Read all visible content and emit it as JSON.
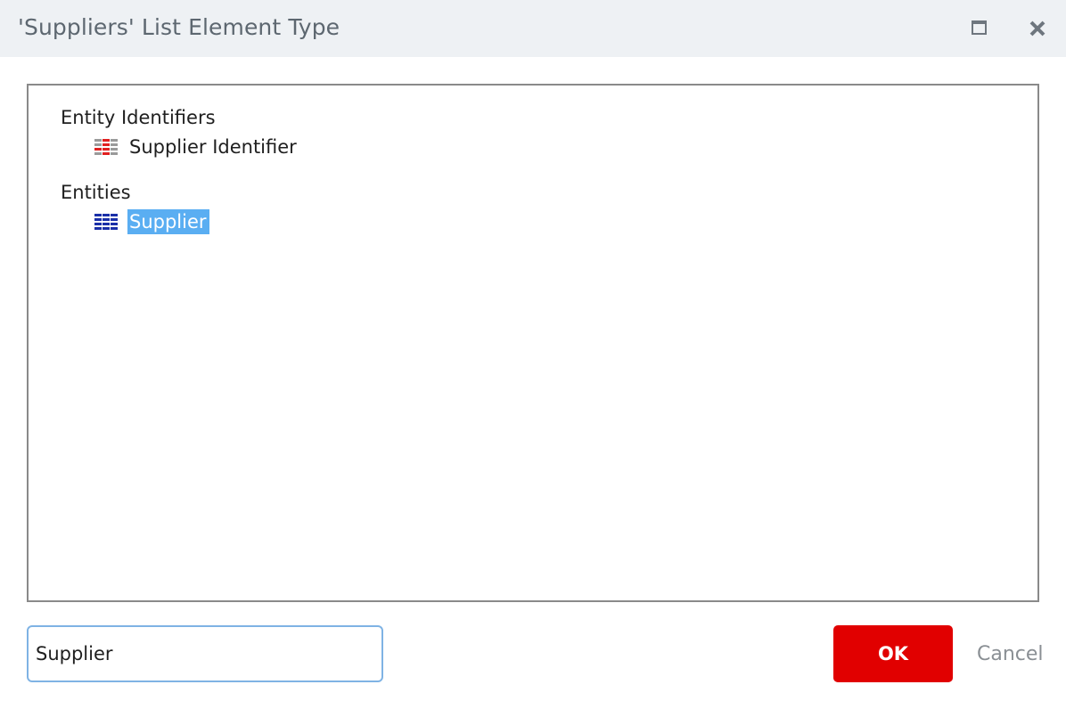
{
  "dialog": {
    "title": "'Suppliers' List Element Type",
    "titlebar_buttons": {
      "maximize_icon": "maximize-icon",
      "close_icon": "close-icon"
    }
  },
  "tree": {
    "groups": [
      {
        "label": "Entity Identifiers",
        "items": [
          {
            "label": "Supplier Identifier",
            "icon": "identifier-table-icon",
            "icon_color": "#e02020",
            "selected": false
          }
        ]
      },
      {
        "label": "Entities",
        "items": [
          {
            "label": "Supplier",
            "icon": "entity-table-icon",
            "icon_color": "#1a2fa8",
            "selected": true
          }
        ]
      }
    ]
  },
  "search": {
    "value": "Supplier",
    "placeholder": ""
  },
  "buttons": {
    "ok_label": "OK",
    "cancel_label": "Cancel"
  },
  "colors": {
    "titlebar_bg": "#eef1f4",
    "selection": "#5aaef2",
    "ok_button": "#e10000",
    "input_border": "#7fb3e4"
  }
}
